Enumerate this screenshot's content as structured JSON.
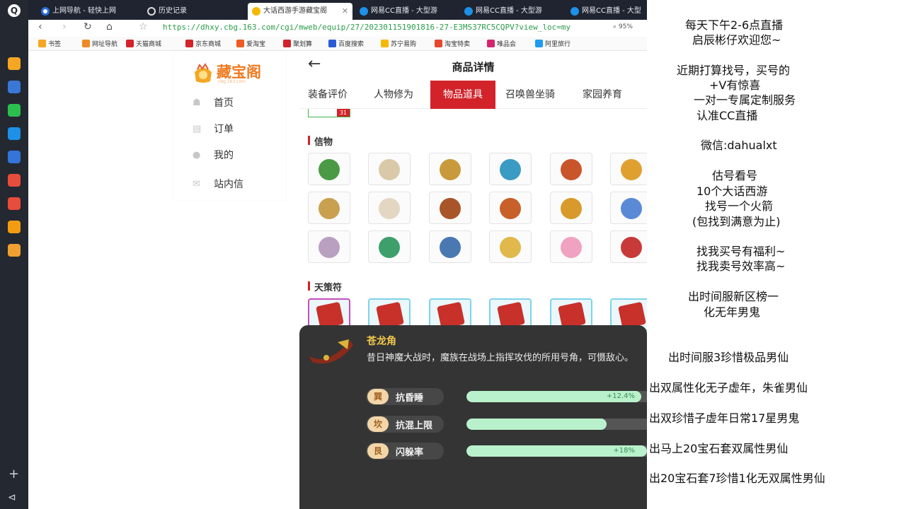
{
  "browser": {
    "tabs": [
      {
        "title": "上网导航 - 轻快上网"
      },
      {
        "title": "历史记录"
      },
      {
        "title": "大话西游手游藏宝阁"
      },
      {
        "title": "网易CC直播 - 大型游"
      },
      {
        "title": "网易CC直播 - 大型游"
      },
      {
        "title": "网易CC直播 - 大型"
      }
    ],
    "url": "https://dhxy.cbg.163.com/cgi/mweb/equip/27/202301151901816-27-E3MS37RC5CQPV?view_loc=my",
    "zoom": "95%",
    "bookmarks": [
      {
        "label": "书签",
        "color": "#f5a623"
      },
      {
        "label": "网址导航",
        "color": "#f08a24"
      },
      {
        "label": "天猫商城",
        "color": "#d2232a"
      },
      {
        "label": "京东商城",
        "color": "#d2232a"
      },
      {
        "label": "爱淘宝",
        "color": "#f05a22"
      },
      {
        "label": "聚划算",
        "color": "#d2232a"
      },
      {
        "label": "百度搜索",
        "color": "#2a5bd7"
      },
      {
        "label": "苏宁易购",
        "color": "#f5b800"
      },
      {
        "label": "淘宝特卖",
        "color": "#e8462d"
      },
      {
        "label": "唯品会",
        "color": "#d6246e"
      },
      {
        "label": "阿里旅行",
        "color": "#1d9bf0"
      }
    ]
  },
  "sidebar": {
    "brand": "藏宝阁",
    "brand_sub": "cbg.163.com",
    "items": [
      {
        "label": "首页",
        "icon": "home-icon"
      },
      {
        "label": "订单",
        "icon": "order-icon"
      },
      {
        "label": "我的",
        "icon": "user-icon"
      },
      {
        "label": "站内信",
        "icon": "mail-icon"
      }
    ]
  },
  "main": {
    "title": "商品详情",
    "tabs": [
      "装备评价",
      "人物修为",
      "物品道具",
      "召唤兽坐骑",
      "家园养育"
    ],
    "active_tab": "物品道具",
    "badge_count": "31",
    "section_items": "信物",
    "section_cards": "天策符",
    "item_colors": [
      "#4a9a45",
      "#d9c9a8",
      "#c99a3c",
      "#3a9bc4",
      "#c9552a",
      "#e0a030",
      "#c9a050",
      "#e3d7c3",
      "#a8552a",
      "#c8602a",
      "#d89a2a",
      "#5a8ad6",
      "#b9a0c0",
      "#3da06b",
      "#4a78b0",
      "#e1b84c",
      "#f0a3c0",
      "#c83a3a"
    ]
  },
  "popup": {
    "name": "苍龙角",
    "desc": "昔日神魔大战时，魔族在战场上指挥攻伐的所用号角，可慑敌心。",
    "attrs": [
      {
        "glyph": "巽",
        "label": "抗昏睡",
        "value": "+12.4%",
        "fill": 0.95
      },
      {
        "glyph": "坎",
        "label": "抗混上限",
        "value": "",
        "fill": 0.76
      },
      {
        "glyph": "艮",
        "label": "闪躲率",
        "value": "+18%",
        "fill": 0.98
      }
    ]
  },
  "promo": {
    "lines": [
      "每天下午2-6点直播",
      "启辰彬仔欢迎您~",
      "近期打算找号，买号的",
      "+V有惊喜",
      "一对一专属定制服务",
      "认准CC直播",
      "微信:dahualxt",
      "估号看号",
      "10个大话西游",
      "找号一个火箭",
      "(包找到满意为止)",
      "找我买号有福利~",
      "找我卖号效率高~",
      "出时间服新区榜一",
      "化无年男鬼",
      "出时间服3珍惜极品男仙",
      "出双属性化无子虚年，朱雀男仙",
      "出双珍惜子虚年日常17星男鬼",
      "出马上20宝石套双属性男仙",
      "出20宝石套7珍惜1化无双属性男仙"
    ]
  }
}
